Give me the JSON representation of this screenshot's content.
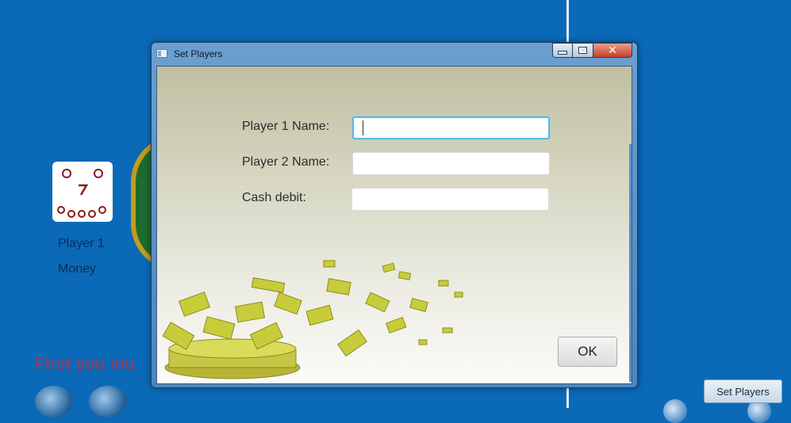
{
  "background_app": {
    "player_label": "Player 1",
    "money_label": "Money",
    "warning_text": "First you mu",
    "set_players_button": "Set Players"
  },
  "dialog": {
    "title": "Set Players",
    "fields": [
      {
        "label": "Player 1 Name:",
        "value": "",
        "placeholder": ""
      },
      {
        "label": "Player 2 Name:",
        "value": "",
        "placeholder": ""
      },
      {
        "label": "Cash debit:",
        "value": "",
        "placeholder": ""
      }
    ],
    "ok_label": "OK",
    "close_glyph": "✕"
  },
  "colors": {
    "desktop_blue": "#0a6ab8",
    "focus_ring": "#57b8dd",
    "money_green": "#c8cc3a"
  },
  "icons": [
    "app-window-icon",
    "minimize-icon",
    "maximize-icon",
    "close-icon",
    "dice-icon",
    "player-avatar-icon"
  ]
}
